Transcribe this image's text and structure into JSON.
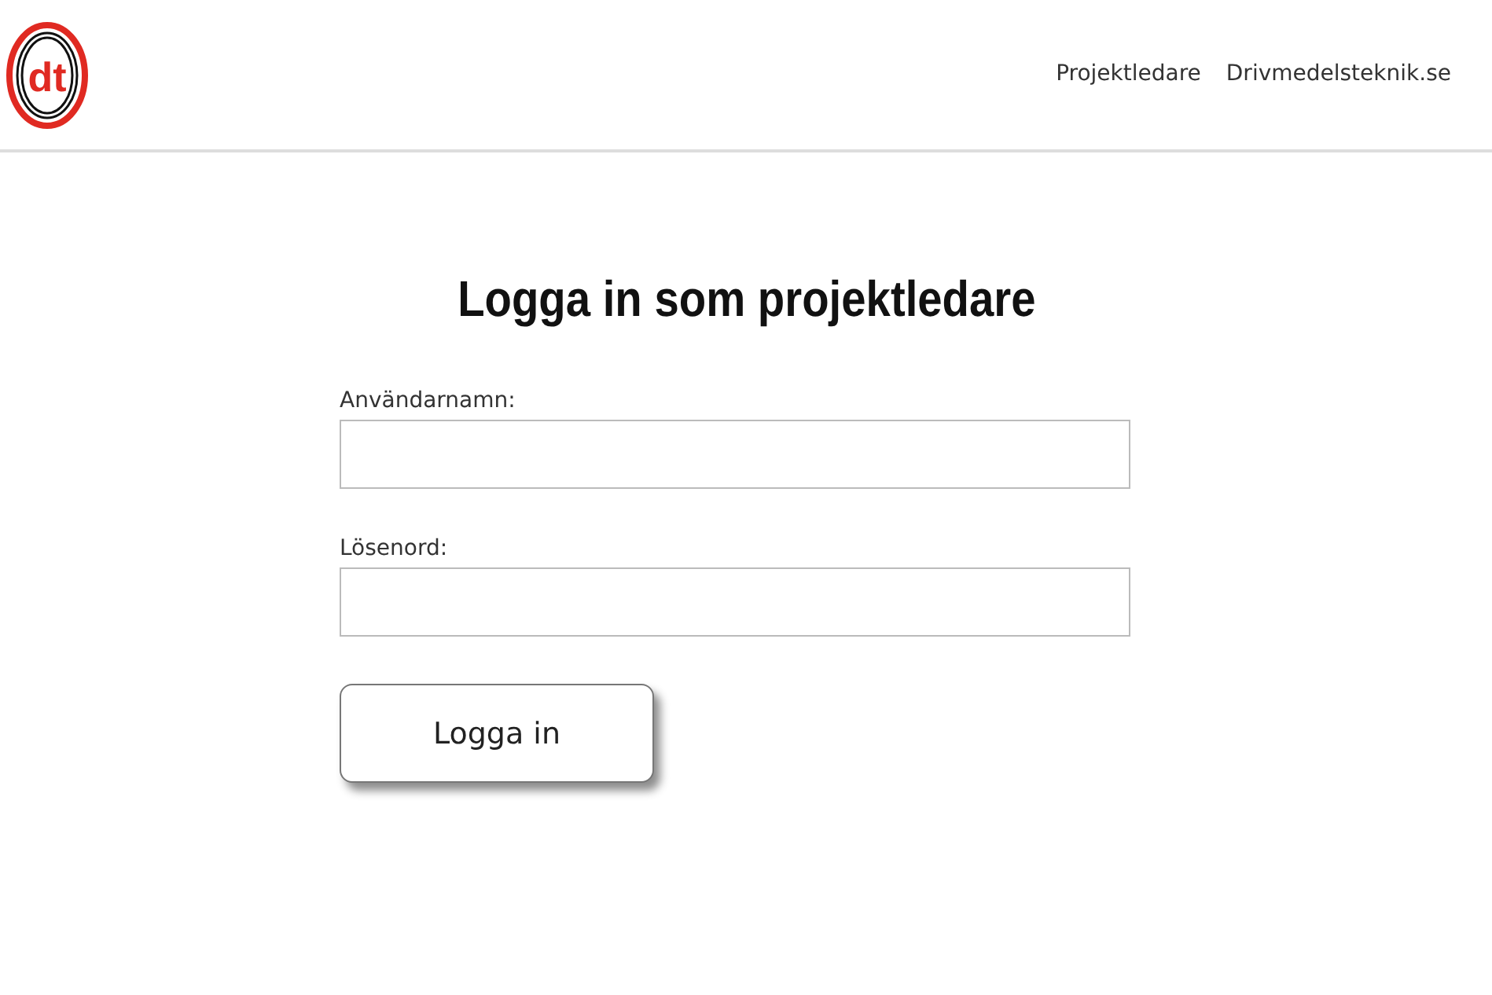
{
  "logo": {
    "text": "dt"
  },
  "nav": [
    {
      "label": "Projektledare"
    },
    {
      "label": "Drivmedelsteknik.se"
    }
  ],
  "title": "Logga in som projektledare",
  "fields": [
    {
      "label": "Användarnamn:"
    },
    {
      "label": "Lösenord:"
    }
  ],
  "button": "Logga in"
}
